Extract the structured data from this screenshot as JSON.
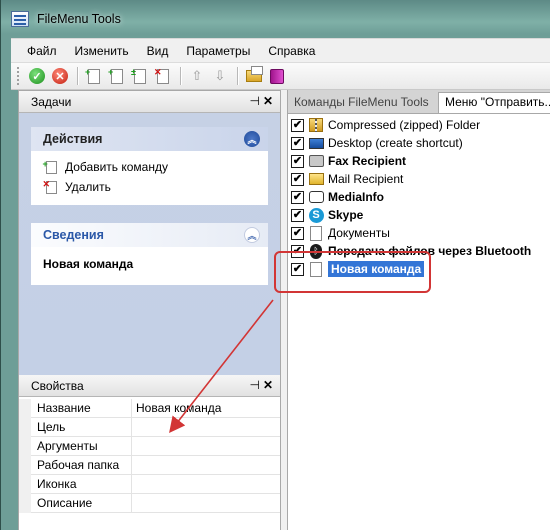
{
  "window": {
    "title": "FileMenu Tools"
  },
  "menu": [
    {
      "label": "Файл"
    },
    {
      "label": "Изменить"
    },
    {
      "label": "Вид"
    },
    {
      "label": "Параметры"
    },
    {
      "label": "Справка"
    }
  ],
  "toolbar": {
    "icons": [
      "apply-icon",
      "cancel-icon",
      "add-command-icon",
      "add-submenu-icon",
      "add-separator-icon",
      "delete-icon",
      "move-up-icon",
      "move-down-icon",
      "options-icon",
      "help-icon"
    ]
  },
  "tasks_panel": {
    "title": "Задачи",
    "actions": {
      "title": "Действия",
      "items": [
        {
          "label": "Добавить команду",
          "icon": "add-command-icon"
        },
        {
          "label": "Удалить",
          "icon": "delete-icon"
        }
      ]
    },
    "info": {
      "title": "Сведения",
      "text": "Новая команда"
    }
  },
  "properties_panel": {
    "title": "Свойства",
    "rows": [
      {
        "name": "Название",
        "value": "Новая команда"
      },
      {
        "name": "Цель",
        "value": ""
      },
      {
        "name": "Аргументы",
        "value": ""
      },
      {
        "name": "Рабочая папка",
        "value": ""
      },
      {
        "name": "Иконка",
        "value": ""
      },
      {
        "name": "Описание",
        "value": ""
      }
    ]
  },
  "tabs": [
    {
      "label": "Команды FileMenu Tools",
      "active": false
    },
    {
      "label": "Меню \"Отправить...",
      "active": true
    }
  ],
  "send_to_list": [
    {
      "label": "Compressed (zipped) Folder",
      "checked": true,
      "bold": false,
      "icon": "zip-folder-icon"
    },
    {
      "label": "Desktop (create shortcut)",
      "checked": true,
      "bold": false,
      "icon": "desktop-icon"
    },
    {
      "label": "Fax Recipient",
      "checked": true,
      "bold": true,
      "icon": "fax-icon"
    },
    {
      "label": "Mail Recipient",
      "checked": true,
      "bold": false,
      "icon": "mail-icon"
    },
    {
      "label": "MediaInfo",
      "checked": true,
      "bold": true,
      "icon": "mediainfo-icon"
    },
    {
      "label": "Skype",
      "checked": true,
      "bold": true,
      "icon": "skype-icon"
    },
    {
      "label": "Документы",
      "checked": true,
      "bold": false,
      "icon": "documents-icon"
    },
    {
      "label": "Передача файлов через Bluetooth",
      "checked": true,
      "bold": true,
      "icon": "bluetooth-icon"
    },
    {
      "label": "Новая команда",
      "checked": true,
      "bold": true,
      "selected": true,
      "icon": "new-command-icon"
    }
  ],
  "annotation": {
    "box_color": "#d23535",
    "arrow_color": "#d23535"
  }
}
